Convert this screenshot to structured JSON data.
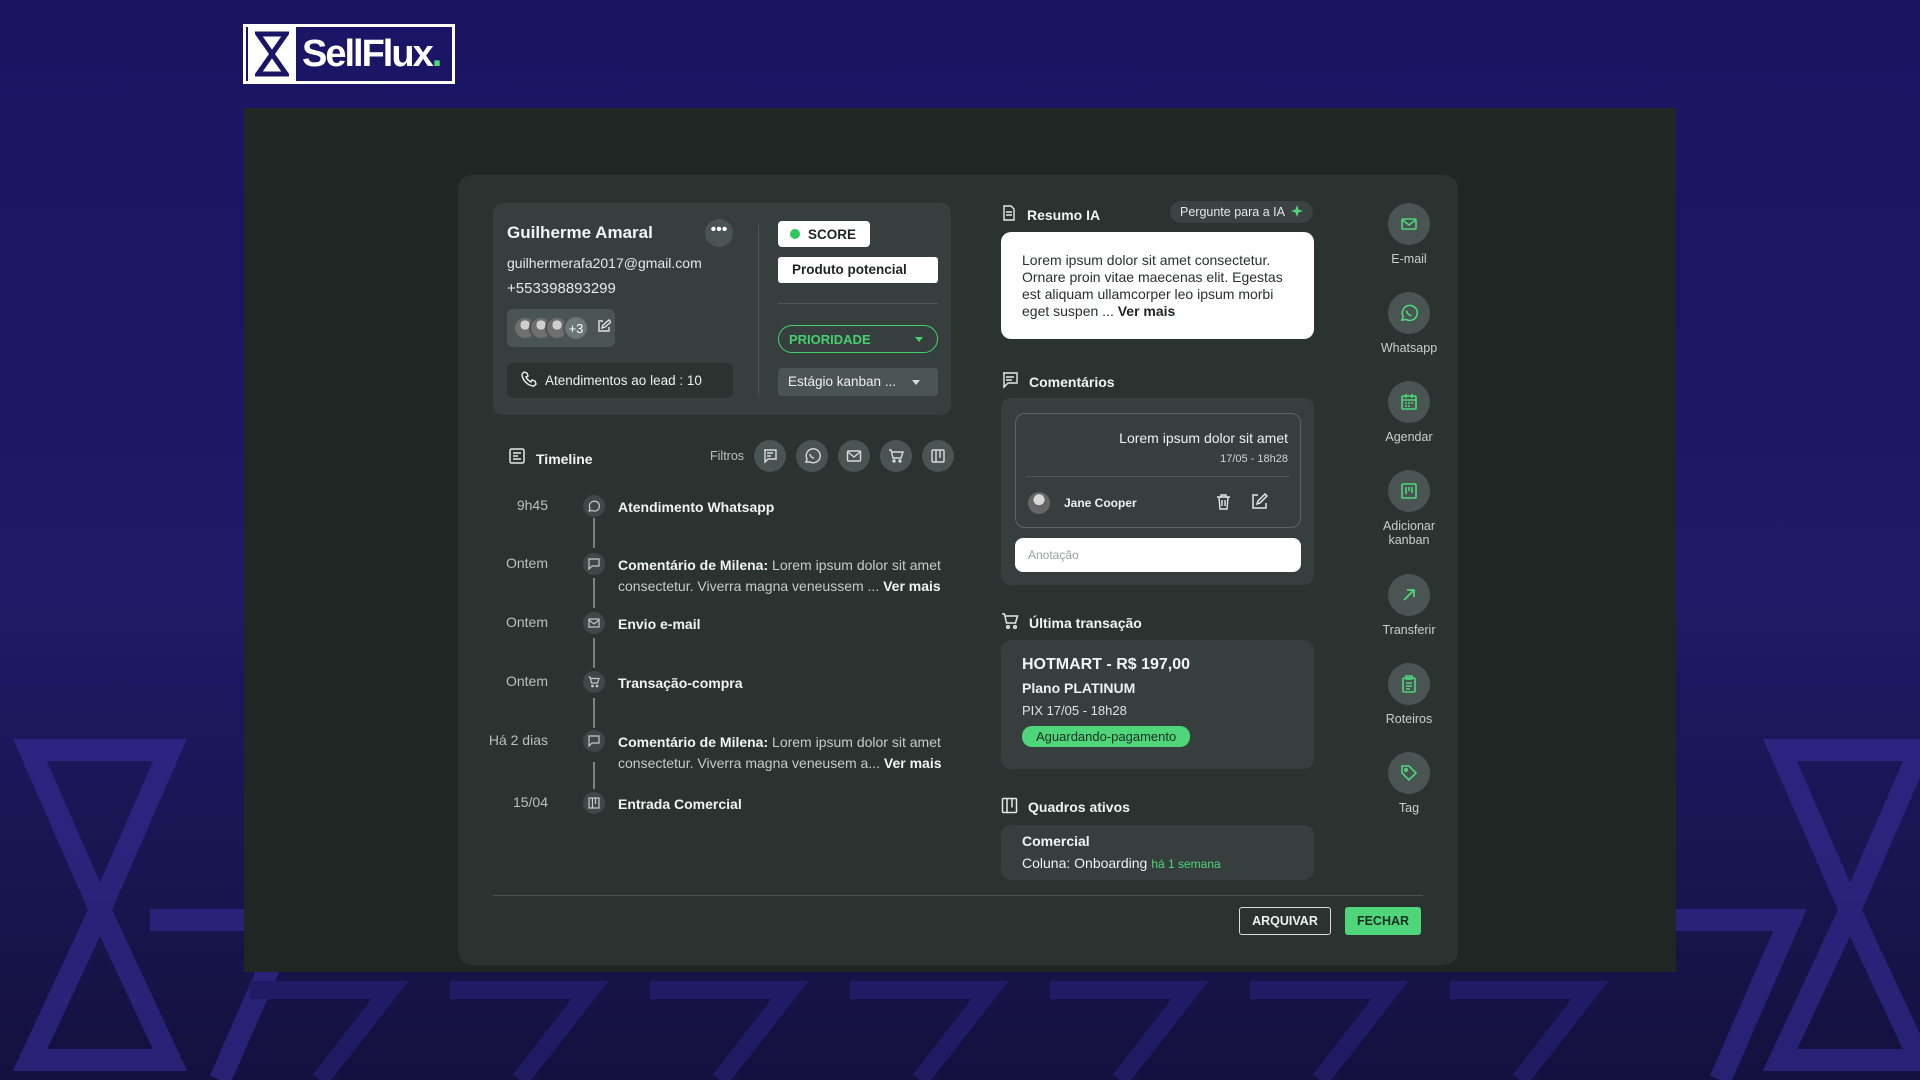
{
  "brand": {
    "name": "SellFlux",
    "dot": "."
  },
  "lead": {
    "name": "Guilherme Amaral",
    "email": "guilhermerafa2017@gmail.com",
    "phone": "+553398893299",
    "extra_members": "+3",
    "attendances_label": "Atendimentos ao lead : 10",
    "score_label": "SCORE",
    "tag": "Produto potencial",
    "priority": "PRIORIDADE",
    "kanban_stage": "Estágio kanban ..."
  },
  "timeline": {
    "title": "Timeline",
    "filters_label": "Filtros",
    "items": [
      {
        "time": "9h45",
        "icon": "whatsapp-icon",
        "title": "Atendimento Whatsapp",
        "text": "",
        "more": ""
      },
      {
        "time": "Ontem",
        "icon": "comment-icon",
        "title": "Comentário de Milena:",
        "text": " Lorem ipsum dolor sit amet consectetur. Viverra magna veneussem ... ",
        "more": "Ver mais"
      },
      {
        "time": "Ontem",
        "icon": "mail-icon",
        "title": "Envio e-mail",
        "text": "",
        "more": ""
      },
      {
        "time": "Ontem",
        "icon": "cart-icon",
        "title": "Transação-compra",
        "text": "",
        "more": ""
      },
      {
        "time": "Há 2 dias",
        "icon": "comment-icon",
        "title": "Comentário de Milena:",
        "text": " Lorem ipsum dolor sit amet consectetur. Viverra magna veneusem a... ",
        "more": "Ver mais"
      },
      {
        "time": "15/04",
        "icon": "kanban-icon",
        "title": "Entrada Comercial",
        "text": "",
        "more": ""
      }
    ]
  },
  "ia": {
    "title": "Resumo IA",
    "ask_label": "Pergunte para a IA",
    "summary": "Lorem ipsum dolor sit amet consectetur. Ornare proin vitae maecenas elit. Egestas est aliquam ullamcorper leo ipsum morbi eget suspen ... ",
    "more": "Ver mais"
  },
  "comments": {
    "title": "Comentários",
    "text": "Lorem ipsum dolor sit amet",
    "date": "17/05 - 18h28",
    "author": "Jane Cooper",
    "input_placeholder": "Anotação"
  },
  "transaction": {
    "title": "Última transação",
    "headline": "HOTMART - R$ 197,00",
    "plan": "Plano PLATINUM",
    "pix": "PIX 17/05 - 18h28",
    "status": "Aguardando-pagamento"
  },
  "boards": {
    "title": "Quadros ativos",
    "name": "Comercial",
    "column": "Coluna: Onboarding",
    "time": "há 1 semana"
  },
  "actions": [
    {
      "label": "E-mail",
      "icon": "mail-icon"
    },
    {
      "label": "Whatsapp",
      "icon": "whatsapp-icon"
    },
    {
      "label": "Agendar",
      "icon": "calendar-icon"
    },
    {
      "label": "Adicionar kanban",
      "icon": "kanban-icon"
    },
    {
      "label": "Transferir",
      "icon": "arrow-up-right-icon"
    },
    {
      "label": "Roteiros",
      "icon": "clipboard-icon"
    },
    {
      "label": "Tag",
      "icon": "tag-icon"
    }
  ],
  "footer": {
    "archive_label": "ARQUIVAR",
    "close_label": "FECHAR"
  },
  "colors": {
    "accent": "#4fd67a",
    "background": "#1b1566",
    "panel": "#2b3331"
  }
}
